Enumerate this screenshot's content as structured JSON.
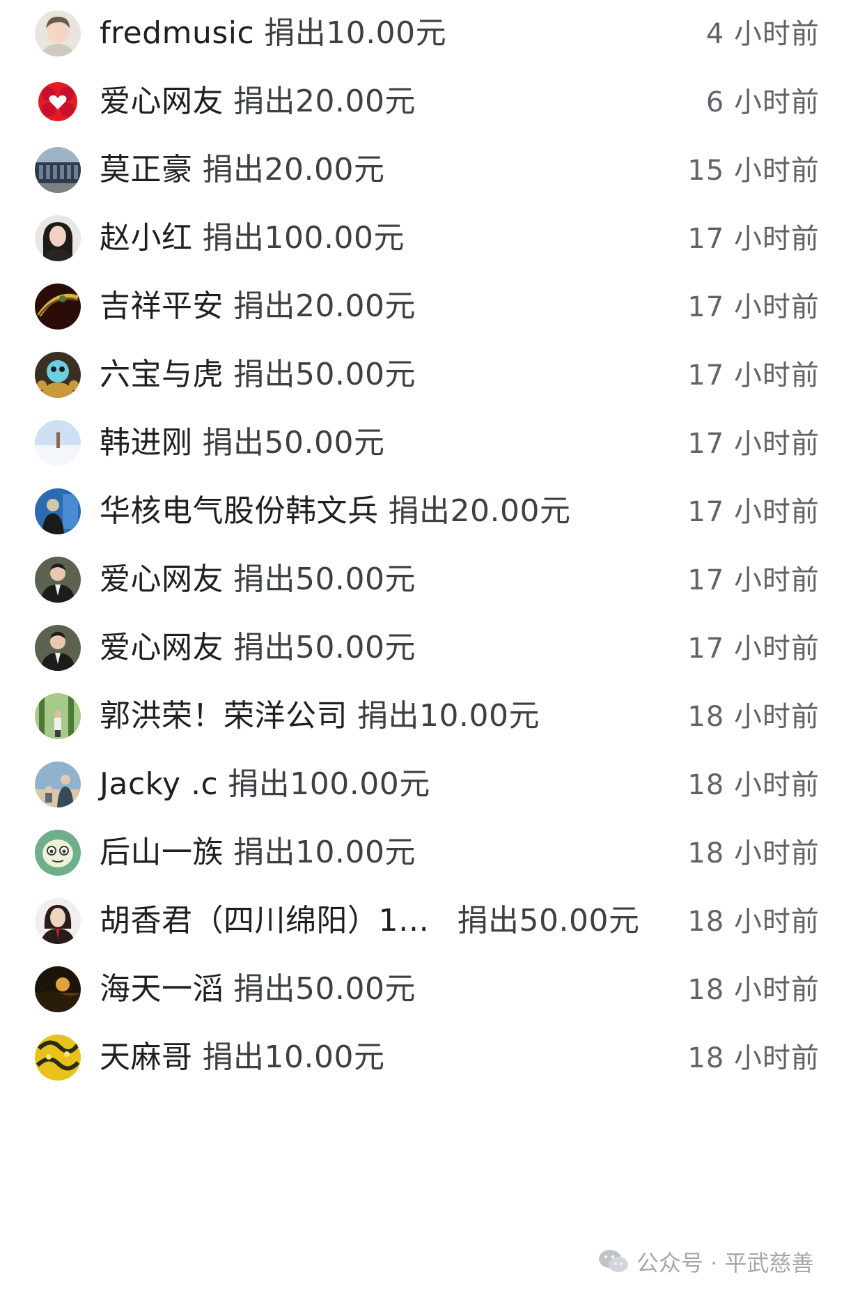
{
  "donations": [
    {
      "name": "fredmusic",
      "amount": "捐出10.00元",
      "time": "4 小时前",
      "avatar": "portrait-man-light-hair",
      "avatar_colors": [
        "#e8e4de",
        "#6b5a4e",
        "#f1d7c4"
      ]
    },
    {
      "name": "爱心网友",
      "amount": "捐出20.00元",
      "time": "6 小时前",
      "avatar": "red-heart-flower-logo",
      "avatar_colors": [
        "#e31b23",
        "#ffffff",
        "#c8102e"
      ]
    },
    {
      "name": "莫正豪",
      "amount": "捐出20.00元",
      "time": "15 小时前",
      "avatar": "building-photo",
      "avatar_colors": [
        "#6d7f93",
        "#2d3b4a",
        "#9fb3c6"
      ]
    },
    {
      "name": "赵小红",
      "amount": "捐出100.00元",
      "time": "17 小时前",
      "avatar": "portrait-woman-dark-hair",
      "avatar_colors": [
        "#e9e6e3",
        "#1e1a18",
        "#efd2c1"
      ]
    },
    {
      "name": "吉祥平安",
      "amount": "捐出20.00元",
      "time": "17 小时前",
      "avatar": "jade-bracelet-dark",
      "avatar_colors": [
        "#2a0c08",
        "#7a4a1a",
        "#d4b64a"
      ]
    },
    {
      "name": "六宝与虎",
      "amount": "捐出50.00元",
      "time": "17 小时前",
      "avatar": "cartoon-tiger",
      "avatar_colors": [
        "#3a2f22",
        "#c99a3a",
        "#6dd0e0"
      ]
    },
    {
      "name": "韩进刚",
      "amount": "捐出50.00元",
      "time": "17 小时前",
      "avatar": "snow-landscape",
      "avatar_colors": [
        "#cfe0f2",
        "#f3f7fb",
        "#8a6a4a"
      ]
    },
    {
      "name": "华核电气股份韩文兵",
      "amount": "捐出20.00元",
      "time": "17 小时前",
      "avatar": "man-at-event",
      "avatar_colors": [
        "#2b6cb0",
        "#1a1a1a",
        "#d6c6a8"
      ]
    },
    {
      "name": "爱心网友",
      "amount": "捐出50.00元",
      "time": "17 小时前",
      "avatar": "man-in-suit",
      "avatar_colors": [
        "#5b6350",
        "#1c1c1c",
        "#e8c9b0"
      ]
    },
    {
      "name": "爱心网友",
      "amount": "捐出50.00元",
      "time": "17 小时前",
      "avatar": "man-in-suit",
      "avatar_colors": [
        "#5b6350",
        "#1c1c1c",
        "#e8c9b0"
      ]
    },
    {
      "name": "郭洪荣！荣洋公司",
      "amount": "捐出10.00元",
      "time": "18 小时前",
      "avatar": "person-in-forest",
      "avatar_colors": [
        "#4c7a36",
        "#a7c98a",
        "#f0f0f0"
      ]
    },
    {
      "name": "Jacky .c",
      "amount": "捐出100.00元",
      "time": "18 小时前",
      "avatar": "people-outdoors",
      "avatar_colors": [
        "#8fb3cf",
        "#3a4a5a",
        "#d9c7a8"
      ]
    },
    {
      "name": "后山一族",
      "amount": "捐出10.00元",
      "time": "18 小时前",
      "avatar": "cartoon-face",
      "avatar_colors": [
        "#6fae8a",
        "#eef2d8",
        "#3b3b3b"
      ]
    },
    {
      "name": "胡香君（四川绵阳）1…",
      "amount": "捐出50.00元",
      "time": "18 小时前",
      "avatar": "portrait-woman-suit",
      "avatar_colors": [
        "#f2eeee",
        "#2a1c1a",
        "#c0202a"
      ]
    },
    {
      "name": "海天一滔",
      "amount": "捐出50.00元",
      "time": "18 小时前",
      "avatar": "sunset-landscape",
      "avatar_colors": [
        "#1c1408",
        "#e0a23a",
        "#5a3a12"
      ]
    },
    {
      "name": "天麻哥",
      "amount": "捐出10.00元",
      "time": "18 小时前",
      "avatar": "yellow-snake-pattern",
      "avatar_colors": [
        "#e7c21a",
        "#2a2a1a",
        "#f5e27a"
      ]
    }
  ],
  "watermark": {
    "icon": "wechat-icon",
    "text": "公众号 · 平武慈善"
  }
}
